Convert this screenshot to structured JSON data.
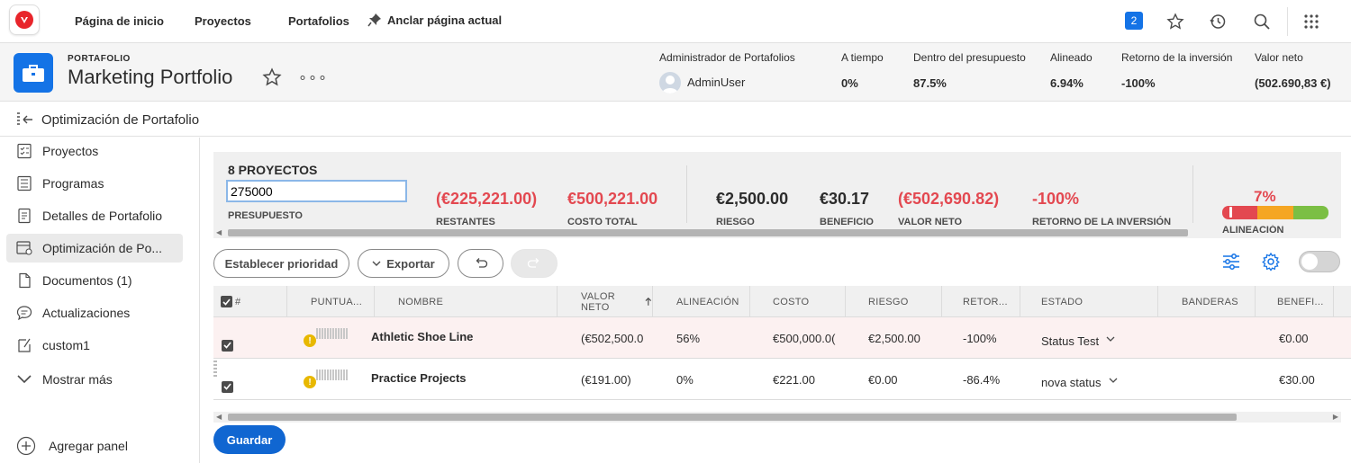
{
  "topnav": {
    "home": "Página de inicio",
    "projects": "Proyectos",
    "portfolios": "Portafolios",
    "pin": "Anclar página actual",
    "notif_count": "2"
  },
  "header": {
    "kicker": "PORTAFOLIO",
    "title": "Marketing Portfolio",
    "more": "∘∘∘",
    "admin_label": "Administrador de Portafolios",
    "admin_user": "AdminUser",
    "metrics": [
      {
        "label": "A tiempo",
        "value": "0%"
      },
      {
        "label": "Dentro del presupuesto",
        "value": "87.5%"
      },
      {
        "label": "Alineado",
        "value": "6.94%"
      },
      {
        "label": "Retorno de la inversión",
        "value": "-100%"
      },
      {
        "label": "Valor neto",
        "value": "(502.690,83 €)"
      }
    ]
  },
  "subheader": {
    "title": "Optimización de Portafolio"
  },
  "sidebar": {
    "items": [
      {
        "label": "Proyectos"
      },
      {
        "label": "Programas"
      },
      {
        "label": "Detalles de Portafolio"
      },
      {
        "label": "Optimización de Po..."
      },
      {
        "label": "Documentos (1)"
      },
      {
        "label": "Actualizaciones"
      },
      {
        "label": "custom1"
      },
      {
        "label": "Mostrar más"
      }
    ],
    "add_panel": "Agregar panel"
  },
  "summary": {
    "count": "8 PROYECTOS",
    "budget_value": "275000",
    "budget_label": "PRESUPUESTO",
    "remaining_value": "(€225,221.00)",
    "remaining_label": "RESTANTES",
    "total_cost_value": "€500,221.00",
    "total_cost_label": "COSTO TOTAL",
    "risk_value": "€2,500.00",
    "risk_label": "RIESGO",
    "benefit_value": "€30.17",
    "benefit_label": "BENEFICIO",
    "net_value": "(€502,690.82)",
    "net_label": "VALOR NETO",
    "roi_value": "-100%",
    "roi_label": "RETORNO DE LA INVERSIÓN",
    "alignment_value": "7%",
    "alignment_label": "ALINEACIÓN",
    "alignment_fraction": 0.07
  },
  "toolbar": {
    "set_priority": "Establecer prioridad",
    "export": "Exportar"
  },
  "grid": {
    "columns": [
      "#",
      "PUNTUA...",
      "NOMBRE",
      "VALOR NETO",
      "ALINEACIÓN",
      "COSTO",
      "RIESGO",
      "RETOR...",
      "ESTADO",
      "BANDERAS",
      "BENEFI..."
    ],
    "rows": [
      {
        "name": "Athletic Shoe Line",
        "net": "(€502,500.0",
        "align": "56%",
        "cost": "€500,000.0(",
        "risk": "€2,500.00",
        "roi": "-100%",
        "status": "Status Test",
        "benefit": "€0.00"
      },
      {
        "name": "Practice Projects",
        "net": "(€191.00)",
        "align": "0%",
        "cost": "€221.00",
        "risk": "€0.00",
        "roi": "-86.4%",
        "status": "nova status",
        "benefit": "€30.00"
      }
    ]
  },
  "save_label": "Guardar",
  "colors": {
    "accent": "#1473e6",
    "negative": "#e34850",
    "link": "#1660b5"
  }
}
